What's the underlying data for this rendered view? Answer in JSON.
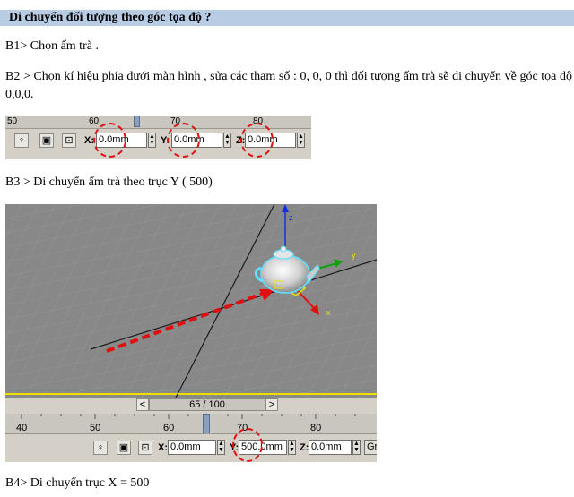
{
  "heading": "Di chuyển đối tượng theo góc tọa độ  ?",
  "steps": {
    "b1": "B1> Chọn ấm trà .",
    "b2": "B2 > Chọn kí hiệu phía dưới màn hình , sửa các tham số : 0, 0, 0 thì đối tượng ấm trà sẽ di chuyển về góc tọa độ 0,0,0.",
    "b3": "B3 > Di chuyển ấm trà theo trục Y ( 500)",
    "b4": "B4>  Di chuyển trục X = 500"
  },
  "toolbar1": {
    "ruler_ticks": [
      "50",
      "60",
      "70",
      "80"
    ],
    "x_label": "X:",
    "y_label": "Y:",
    "z_label": "Z:",
    "x_value": "0.0mm",
    "y_value": "0.0mm",
    "z_value": "0.0mm"
  },
  "viewport": {
    "axis_x": "x",
    "axis_y": "y",
    "axis_z": "z"
  },
  "toolbar2": {
    "frame": "65 / 100",
    "prev": "<",
    "next": ">",
    "ruler_ticks": [
      "40",
      "50",
      "60",
      "70",
      "80"
    ],
    "x_label": "X:",
    "y_label": "Y:",
    "z_label": "Z:",
    "x_value": "0.0mm",
    "y_value": "500.0mm",
    "z_value": "0.0mm",
    "grid_label": "Gr"
  },
  "colors": {
    "heading_bg": "#b8cce4",
    "annotation_red": "#e01010",
    "viewport_gray": "#858585",
    "selection_yellow": "#f0e000"
  }
}
